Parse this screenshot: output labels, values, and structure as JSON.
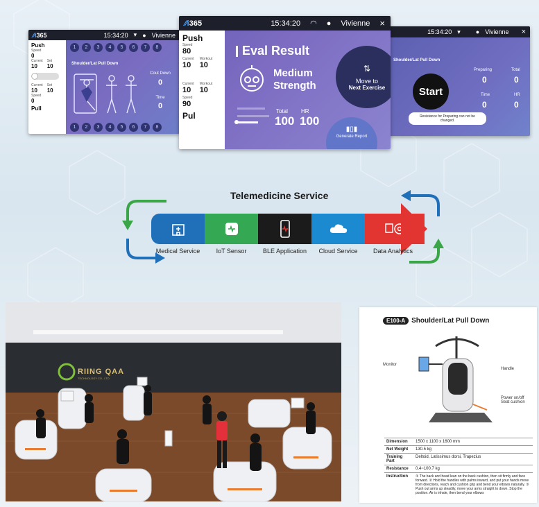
{
  "screen_left": {
    "logo": "365",
    "time": "15:34:20",
    "user": "Vivienne",
    "row_numbers": [
      "1",
      "2",
      "3",
      "4",
      "5",
      "6",
      "7",
      "8"
    ],
    "push_label": "Push",
    "pull_label": "Pull",
    "speed_label": "Speed",
    "speed_value": "0",
    "current_label": "Current",
    "set_label": "Set",
    "current_value": "10",
    "set_value": "10",
    "exercise_title": "Shoulder/Lat Pull Down",
    "count_down_label": "Cout Down",
    "count_value": "0",
    "time_label": "Time",
    "time_value": "0"
  },
  "screen_center": {
    "logo": "365",
    "time": "15:34:20",
    "user": "Vivienne",
    "close": "×",
    "push_label": "Push",
    "pull_label": "Pul",
    "speed_label": "Speed",
    "speed_top_value": "80",
    "speed_bottom_value": "90",
    "current_label": "Current",
    "workout_label": "Workout",
    "current_value": "10",
    "workout_value": "10",
    "current_value_2": "10",
    "workout_value_2": "10",
    "eval_title": "Eval Result",
    "result_line1": "Medium",
    "result_line2": "Strength",
    "total_label": "Total",
    "total_value": "100",
    "hr_label": "HR",
    "hr_value": "100",
    "move_line1": "Move to",
    "move_line2": "Next Exercise",
    "report_label": "Generate Report"
  },
  "screen_right": {
    "time": "15:34:20",
    "user": "Vivienne",
    "close": "×",
    "exercise_title": "Shoulder/Lat Pull Down",
    "start_label": "Start",
    "toast": "Resistance for Preparing can not be changed.",
    "preparing_label": "Preparing",
    "total_label": "Total",
    "preparing_value": "0",
    "total_value": "0",
    "time_label": "Time",
    "hr_label": "HR",
    "time_value": "0",
    "hr_value": "0"
  },
  "telemedicine": {
    "title": "Telemedicine Service",
    "segments": [
      {
        "label": "Medical Service",
        "color": "#1f6fb9",
        "icon": "hospital-icon"
      },
      {
        "label": "IoT Sensor",
        "color": "#34a853",
        "icon": "heart-monitor-icon"
      },
      {
        "label": "BLE Application",
        "color": "#1b1b1b",
        "icon": "smartphone-icon"
      },
      {
        "label": "Cloud Service",
        "color": "#1b8ad1",
        "icon": "cloud-icon"
      },
      {
        "label": "Data Analytics",
        "color": "#e23431",
        "icon": "analytics-head-icon"
      }
    ],
    "green_arrow_color": "#3aa648",
    "blue_arrow_color": "#1f6fb9"
  },
  "gym": {
    "brand": "RIING QAA",
    "brand_sub": "TECHNOLOGY CO., LTD"
  },
  "spec": {
    "model_badge": "E100-A",
    "title": "Shoulder/Lat Pull Down",
    "callout_monitor": "Monitor",
    "callout_handle": "Handle",
    "callout_seat": "Power on/off\nSeat cushion",
    "rows": [
      {
        "key": "Dimension",
        "value": "1500 x 1100 x 1600 mm"
      },
      {
        "key": "Net Weight",
        "value": "130.5 kg"
      },
      {
        "key": "Training Part",
        "value": "Deltoid, Latissimus dorsi, Trapezius"
      },
      {
        "key": "Resistance",
        "value": "0.4~100.7 kg"
      },
      {
        "key": "Instruction",
        "value": "① The back and head lean on the back cushion, then sit firmly and face forward. ② Hold the handles with palms inward, and put your hands move from directions, reach and cushion grip and bend your elbows naturally. ③ Push out arms up steadily, move your arms straight to down. Stop the position. Air is inhale, then bend your elbows"
      }
    ]
  }
}
